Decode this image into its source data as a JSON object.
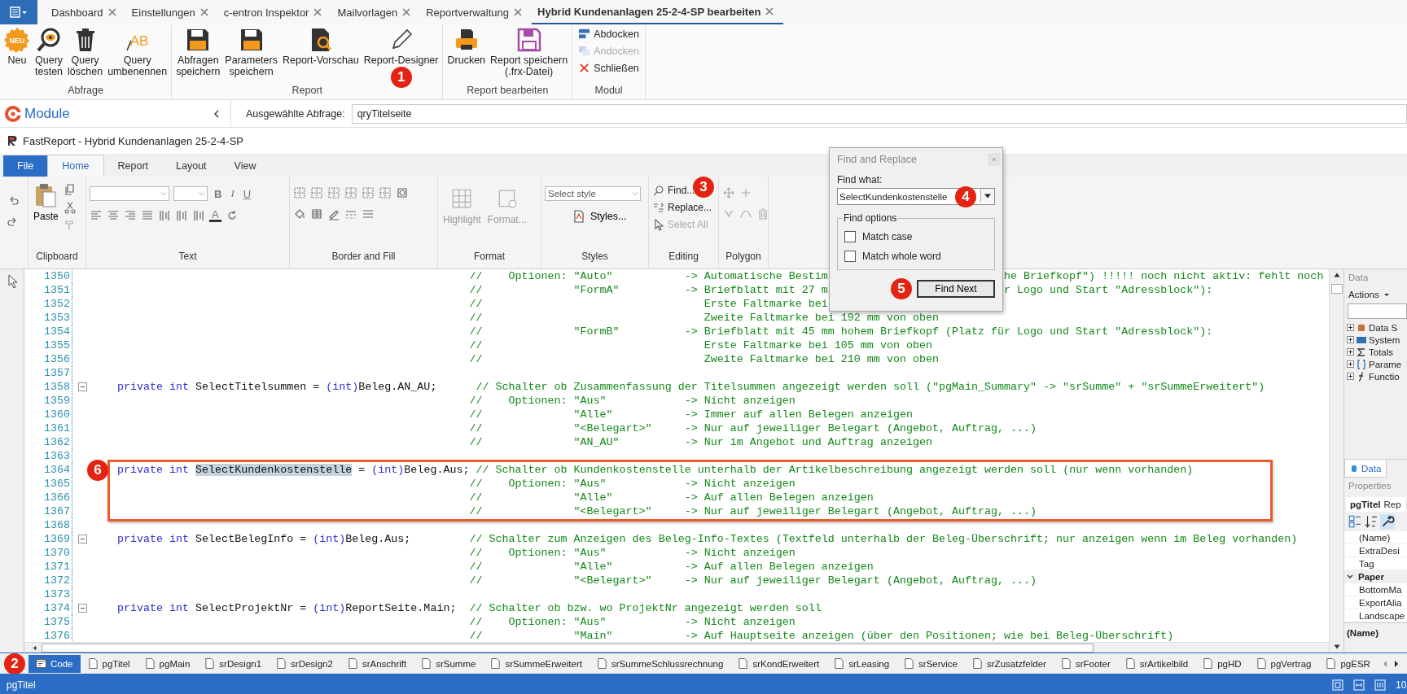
{
  "top_tabs": [
    {
      "label": "Dashboard",
      "selected": false
    },
    {
      "label": "Einstellungen",
      "selected": false
    },
    {
      "label": "c-entron Inspektor",
      "selected": false
    },
    {
      "label": "Mailvorlagen",
      "selected": false
    },
    {
      "label": "Reportverwaltung",
      "selected": false
    },
    {
      "label": "Hybrid Kundenanlagen 25-2-4-SP bearbeiten",
      "selected": true
    }
  ],
  "ribbon": {
    "groups": [
      {
        "label": "Abfrage",
        "buttons": [
          {
            "kind": "big",
            "badge": "NEU",
            "lines": [
              "Neu"
            ]
          },
          {
            "kind": "big",
            "lines": [
              "Query",
              "testen"
            ]
          },
          {
            "kind": "big",
            "lines": [
              "Query",
              "löschen"
            ]
          },
          {
            "kind": "big",
            "badge": "AB",
            "lines": [
              "Query",
              "umbenennen"
            ]
          }
        ]
      },
      {
        "label": "Report",
        "buttons": [
          {
            "kind": "big",
            "lines": [
              "Abfragen",
              "speichern"
            ]
          },
          {
            "kind": "big",
            "lines": [
              "Parameters",
              "speichern"
            ]
          },
          {
            "kind": "big",
            "lines": [
              "Report-Vorschau"
            ]
          },
          {
            "kind": "big",
            "lines": [
              "Report-Designer"
            ],
            "callout": "1"
          }
        ]
      },
      {
        "label": "Report bearbeiten",
        "buttons": [
          {
            "kind": "big",
            "lines": [
              "Drucken"
            ]
          },
          {
            "kind": "big",
            "lines": [
              "Report speichern",
              "(.frx-Datei)"
            ]
          }
        ]
      },
      {
        "label": "Modul",
        "buttons": [
          {
            "kind": "small",
            "lines": [
              "Abdocken"
            ],
            "disabled": false
          },
          {
            "kind": "small",
            "lines": [
              "Andocken"
            ],
            "disabled": true
          },
          {
            "kind": "small",
            "lines": [
              "Schließen"
            ],
            "disabled": false
          }
        ]
      }
    ]
  },
  "module_bar": {
    "title": "Module",
    "query_label": "Ausgewählte Abfrage:",
    "query_value": "qryTitelseite"
  },
  "designer": {
    "title": "FastReport - Hybrid Kundenanlagen 25-2-4-SP",
    "tabs": [
      {
        "label": "File",
        "kind": "file",
        "selected": false
      },
      {
        "label": "Home",
        "kind": "tab",
        "selected": true
      },
      {
        "label": "Report",
        "kind": "tab",
        "selected": false
      },
      {
        "label": "Layout",
        "kind": "tab",
        "selected": false
      },
      {
        "label": "View",
        "kind": "tab",
        "selected": false
      }
    ],
    "clipboard": {
      "label": "Clipboard",
      "paste": "Paste"
    },
    "text": {
      "label": "Text",
      "format_buttons": [
        "B",
        "I",
        "U"
      ],
      "font_color": "A"
    },
    "border": {
      "label": "Border and Fill"
    },
    "format": {
      "label": "Format",
      "items": [
        "Highlight",
        "Format..."
      ],
      "disabled": true
    },
    "styles": {
      "label": "Styles",
      "placeholder": "Select style",
      "button": "Styles..."
    },
    "editing": {
      "label": "Editing",
      "items": [
        {
          "label": "Find...",
          "disabled": false,
          "callout": "3"
        },
        {
          "label": "Replace...",
          "disabled": false
        },
        {
          "label": "Select All",
          "disabled": true
        }
      ]
    },
    "polygon": {
      "label": "Polygon"
    }
  },
  "editor": {
    "lines": [
      {
        "num": "1350",
        "comment": "//    Optionen: \"Auto\"           -> Automatische Bestim",
        "tail": "he Briefkopf\") !!!!! noch nicht aktiv: fehlt noch"
      },
      {
        "num": "1351",
        "comment": "//              \"FormA\"          -> Briefblatt mit 27 m",
        "tail": "r Logo und Start \"Adressblock\"):"
      },
      {
        "num": "1352",
        "comment": "//                                  Erste Faltmarke bei"
      },
      {
        "num": "1353",
        "comment": "//                                  Zweite Faltmarke bei 192 mm von oben"
      },
      {
        "num": "1354",
        "comment": "//              \"FormB\"          -> Briefblatt mit 45 mm hohem Briefkopf (Platz für Logo und Start \"Adressblock\"):"
      },
      {
        "num": "1355",
        "comment": "//                                  Erste Faltmarke bei 105 mm von oben"
      },
      {
        "num": "1356",
        "comment": "//                                  Zweite Faltmarke bei 210 mm von oben"
      },
      {
        "num": "1357"
      },
      {
        "num": "1358",
        "code": [
          {
            "kind": "keyword",
            "t": "private int "
          },
          {
            "kind": "plain",
            "t": "SelectTitelsummen = "
          },
          {
            "kind": "keyword",
            "t": "(int)"
          },
          {
            "kind": "plain",
            "t": "Beleg.AN_AU;      "
          }
        ],
        "comment": "// Schalter ob Zusammenfassung der Titelsummen angezeigt werden soll (\"pgMain_Summary\" -> \"srSumme\" + \"srSummeErweitert\")"
      },
      {
        "num": "1359",
        "comment": "//    Optionen: \"Aus\"            -> Nicht anzeigen"
      },
      {
        "num": "1360",
        "comment": "//              \"Alle\"           -> Immer auf allen Belegen anzeigen"
      },
      {
        "num": "1361",
        "comment": "//              \"<Belegart>\"     -> Nur auf jeweiliger Belegart (Angebot, Auftrag, ...)"
      },
      {
        "num": "1362",
        "comment": "//              \"AN_AU\"          -> Nur im Angebot und Auftrag anzeigen"
      },
      {
        "num": "1363"
      },
      {
        "num": "1364",
        "framed": true,
        "callout": "6",
        "code": [
          {
            "kind": "keyword",
            "t": "private int "
          },
          {
            "kind": "selected",
            "t": "SelectKundenkostenstelle"
          },
          {
            "kind": "plain",
            "t": " = "
          },
          {
            "kind": "keyword",
            "t": "(int)"
          },
          {
            "kind": "plain",
            "t": "Beleg.Aus; "
          }
        ],
        "comment": "// Schalter ob Kundenkostenstelle unterhalb der Artikelbeschreibung angezeigt werden soll (nur wenn vorhanden)"
      },
      {
        "num": "1365",
        "framed": true,
        "comment": "//    Optionen: \"Aus\"            -> Nicht anzeigen"
      },
      {
        "num": "1366",
        "framed": true,
        "comment": "//              \"Alle\"           -> Auf allen Belegen anzeigen"
      },
      {
        "num": "1367",
        "framed": true,
        "comment": "//              \"<Belegart>\"     -> Nur auf jeweiliger Belegart (Angebot, Auftrag, ...)"
      },
      {
        "num": "1368"
      },
      {
        "num": "1369",
        "code": [
          {
            "kind": "keyword",
            "t": "private int "
          },
          {
            "kind": "plain",
            "t": "SelectBelegInfo = "
          },
          {
            "kind": "keyword",
            "t": "(int)"
          },
          {
            "kind": "plain",
            "t": "Beleg.Aus;"
          }
        ],
        "comment": "// Schalter zum Anzeigen des Beleg-Info-Textes (Textfeld unterhalb der Beleg-Überschrift; nur anzeigen wenn im Beleg vorhanden)"
      },
      {
        "num": "1370",
        "comment": "//    Optionen: \"Aus\"            -> Nicht anzeigen"
      },
      {
        "num": "1371",
        "comment": "//              \"Alle\"           -> Auf allen Belegen anzeigen"
      },
      {
        "num": "1372",
        "comment": "//              \"<Belegart>\"     -> Nur auf jeweiliger Belegart (Angebot, Auftrag, ...)"
      },
      {
        "num": "1373"
      },
      {
        "num": "1374",
        "code": [
          {
            "kind": "keyword",
            "t": "private int "
          },
          {
            "kind": "plain",
            "t": "SelectProjektNr = "
          },
          {
            "kind": "keyword",
            "t": "(int)"
          },
          {
            "kind": "plain",
            "t": "ReportSeite.Main;"
          }
        ],
        "comment": "// Schalter ob bzw. wo ProjektNr angezeigt werden soll"
      },
      {
        "num": "1375",
        "comment": "//    Optionen: \"Aus\"            -> Nicht anzeigen"
      },
      {
        "num": "1376",
        "comment": "//              \"Main\"           -> Auf Hauptseite anzeigen (über den Positionen; wie bei Beleg-Überschrift)"
      }
    ]
  },
  "find_dialog": {
    "title": "Find and Replace",
    "find_label": "Find what:",
    "find_value": "SelectKundenkostenstelle",
    "find_callout": "4",
    "options_label": "Find options",
    "options": [
      {
        "label": "Match case",
        "checked": false
      },
      {
        "label": "Match whole word",
        "checked": false
      }
    ],
    "button": "Find Next",
    "button_callout": "5"
  },
  "data_panel": {
    "title": "Data",
    "actions": "Actions",
    "tree": [
      {
        "label": "Data S"
      },
      {
        "label": "System"
      },
      {
        "label": "Totals"
      },
      {
        "label": "Parame"
      },
      {
        "label": "Functio"
      }
    ],
    "tab": "Data"
  },
  "properties": {
    "title": "Properties",
    "object": "pgTitel",
    "object_type": "Rep",
    "rows": [
      {
        "kind": "prop",
        "label": "(Name)"
      },
      {
        "kind": "prop",
        "label": "ExtraDesi"
      },
      {
        "kind": "prop",
        "label": "Tag"
      },
      {
        "kind": "category",
        "label": "Paper",
        "expanded": true
      },
      {
        "kind": "prop",
        "label": "BottomMa"
      },
      {
        "kind": "prop",
        "label": "ExportAlia"
      },
      {
        "kind": "prop",
        "label": "Landscape"
      }
    ],
    "description": "(Name)"
  },
  "page_tabs": {
    "callout": "2",
    "tabs": [
      {
        "label": "Code",
        "kind": "code",
        "selected": true
      },
      {
        "label": "pgTitel",
        "kind": "page",
        "selected": false
      },
      {
        "label": "pgMain",
        "kind": "page",
        "selected": false
      },
      {
        "label": "srDesign1",
        "kind": "page",
        "selected": false
      },
      {
        "label": "srDesign2",
        "kind": "page",
        "selected": false
      },
      {
        "label": "srAnschrift",
        "kind": "page",
        "selected": false
      },
      {
        "label": "srSumme",
        "kind": "page",
        "selected": false
      },
      {
        "label": "srSummeErweitert",
        "kind": "page",
        "selected": false
      },
      {
        "label": "srSummeSchlussrechnung",
        "kind": "page",
        "selected": false
      },
      {
        "label": "srKondErweitert",
        "kind": "page",
        "selected": false
      },
      {
        "label": "srLeasing",
        "kind": "page",
        "selected": false
      },
      {
        "label": "srService",
        "kind": "page",
        "selected": false
      },
      {
        "label": "srZusatzfelder",
        "kind": "page",
        "selected": false
      },
      {
        "label": "srFooter",
        "kind": "page",
        "selected": false
      },
      {
        "label": "srArtikelbild",
        "kind": "page",
        "selected": false
      },
      {
        "label": "pgHD",
        "kind": "page",
        "selected": false
      },
      {
        "label": "pgVertrag",
        "kind": "page",
        "selected": false
      },
      {
        "label": "pgESR",
        "kind": "page",
        "selected": false
      }
    ]
  },
  "status_bar": {
    "text": "pgTitel",
    "zoom": "10"
  }
}
